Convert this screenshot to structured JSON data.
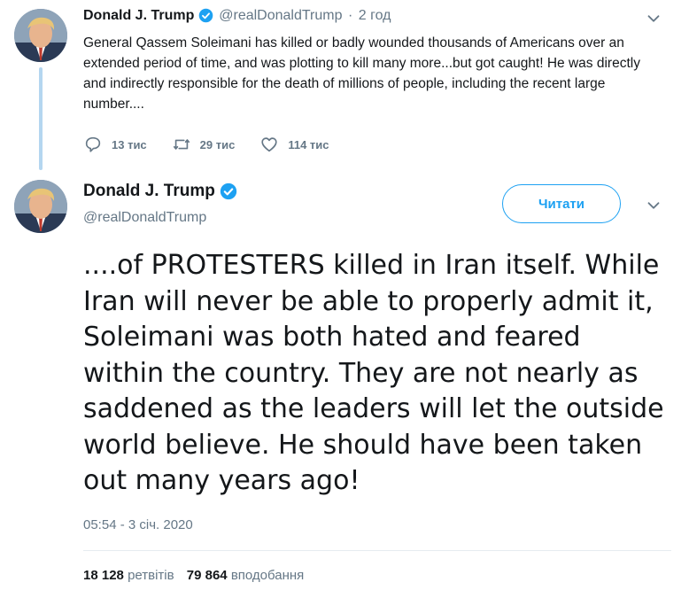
{
  "tweet1": {
    "name": "Donald J. Trump",
    "handle": "@realDonaldTrump",
    "separator": "·",
    "time": "2 год",
    "text": "General Qassem Soleimani has killed or badly wounded thousands of Americans over an extended period of time, and was plotting to kill many more...but got caught! He was directly and indirectly responsible for the death of millions of people, including the recent large number....",
    "replies": "13 тис",
    "retweets": "29 тис",
    "likes": "114 тис",
    "icons": [
      "avatar",
      "verified-badge-icon",
      "chevron-down-icon",
      "reply-icon",
      "retweet-icon",
      "like-icon"
    ]
  },
  "tweet2": {
    "name": "Donald J. Trump",
    "handle": "@realDonaldTrump",
    "follow_label": "Читати",
    "text": "....of PROTESTERS killed in Iran itself. While Iran will never be able to properly admit it, Soleimani was both hated and feared within the country. They are not nearly as saddened as the leaders will let the outside world believe. He should have been taken out many years ago!",
    "timestamp": "05:54 - 3 січ. 2020",
    "retweet_count": "18 128",
    "retweet_label": "ретвітів",
    "like_count": "79 864",
    "like_label": "вподобання"
  },
  "colors": {
    "accent": "#1da1f2",
    "secondary_text": "#657786",
    "primary_text": "#14171a",
    "thread_line": "#b4d6f0"
  }
}
